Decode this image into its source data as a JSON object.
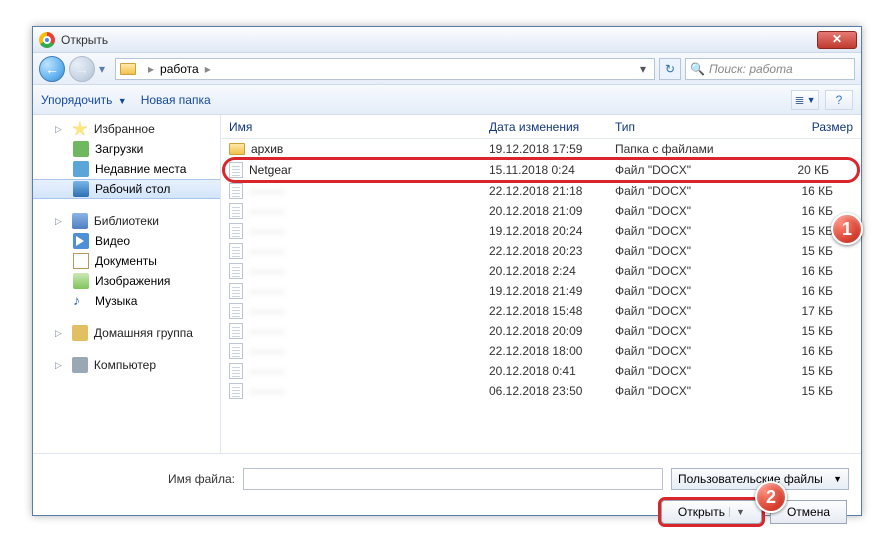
{
  "window": {
    "title": "Открыть"
  },
  "nav": {
    "path_root": "работа",
    "search_placeholder": "Поиск: работа"
  },
  "toolbar": {
    "organize": "Упорядочить",
    "new_folder": "Новая папка"
  },
  "sidebar": {
    "favorites": "Избранное",
    "downloads": "Загрузки",
    "recent": "Недавние места",
    "desktop": "Рабочий стол",
    "libraries": "Библиотеки",
    "videos": "Видео",
    "documents": "Документы",
    "pictures": "Изображения",
    "music": "Музыка",
    "homegroup": "Домашняя группа",
    "computer": "Компьютер"
  },
  "columns": {
    "name": "Имя",
    "date": "Дата изменения",
    "type": "Тип",
    "size": "Размер"
  },
  "files": [
    {
      "name": "архив",
      "date": "19.12.2018 17:59",
      "type": "Папка с файлами",
      "size": "",
      "kind": "folder",
      "sel": false,
      "blur": false
    },
    {
      "name": "Netgear",
      "date": "15.11.2018 0:24",
      "type": "Файл \"DOCX\"",
      "size": "20 КБ",
      "kind": "file",
      "sel": true,
      "blur": false
    },
    {
      "name": "———",
      "date": "22.12.2018 21:18",
      "type": "Файл \"DOCX\"",
      "size": "16 КБ",
      "kind": "file",
      "sel": false,
      "blur": true
    },
    {
      "name": "———",
      "date": "20.12.2018 21:09",
      "type": "Файл \"DOCX\"",
      "size": "16 КБ",
      "kind": "file",
      "sel": false,
      "blur": true
    },
    {
      "name": "———",
      "date": "19.12.2018 20:24",
      "type": "Файл \"DOCX\"",
      "size": "15 КБ",
      "kind": "file",
      "sel": false,
      "blur": true
    },
    {
      "name": "———",
      "date": "22.12.2018 20:23",
      "type": "Файл \"DOCX\"",
      "size": "15 КБ",
      "kind": "file",
      "sel": false,
      "blur": true
    },
    {
      "name": "———",
      "date": "20.12.2018 2:24",
      "type": "Файл \"DOCX\"",
      "size": "16 КБ",
      "kind": "file",
      "sel": false,
      "blur": true
    },
    {
      "name": "———",
      "date": "19.12.2018 21:49",
      "type": "Файл \"DOCX\"",
      "size": "16 КБ",
      "kind": "file",
      "sel": false,
      "blur": true
    },
    {
      "name": "———",
      "date": "22.12.2018 15:48",
      "type": "Файл \"DOCX\"",
      "size": "17 КБ",
      "kind": "file",
      "sel": false,
      "blur": true
    },
    {
      "name": "———",
      "date": "20.12.2018 20:09",
      "type": "Файл \"DOCX\"",
      "size": "15 КБ",
      "kind": "file",
      "sel": false,
      "blur": true
    },
    {
      "name": "———",
      "date": "22.12.2018 18:00",
      "type": "Файл \"DOCX\"",
      "size": "16 КБ",
      "kind": "file",
      "sel": false,
      "blur": true
    },
    {
      "name": "———",
      "date": "20.12.2018 0:41",
      "type": "Файл \"DOCX\"",
      "size": "15 КБ",
      "kind": "file",
      "sel": false,
      "blur": true
    },
    {
      "name": "———",
      "date": "06.12.2018 23:50",
      "type": "Файл \"DOCX\"",
      "size": "15 КБ",
      "kind": "file",
      "sel": false,
      "blur": true
    }
  ],
  "footer": {
    "filename_label": "Имя файла:",
    "filename_value": "",
    "filter": "Пользовательские файлы",
    "open": "Открыть",
    "cancel": "Отмена"
  },
  "callouts": {
    "one": "1",
    "two": "2"
  }
}
